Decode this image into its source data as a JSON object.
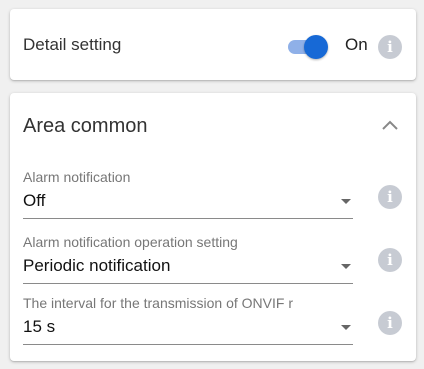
{
  "detail_setting": {
    "label": "Detail setting",
    "toggle_state": "On",
    "info_icon": "info-icon",
    "toggle_color": "#1769d6"
  },
  "area_common": {
    "title": "Area common",
    "collapse_icon": "chevron-up-icon",
    "fields": [
      {
        "label": "Alarm notification",
        "value": "Off"
      },
      {
        "label": "Alarm notification operation setting",
        "value": "Periodic notification"
      },
      {
        "label": "The interval for the transmission of ONVIF r",
        "value": "15 s"
      }
    ]
  }
}
